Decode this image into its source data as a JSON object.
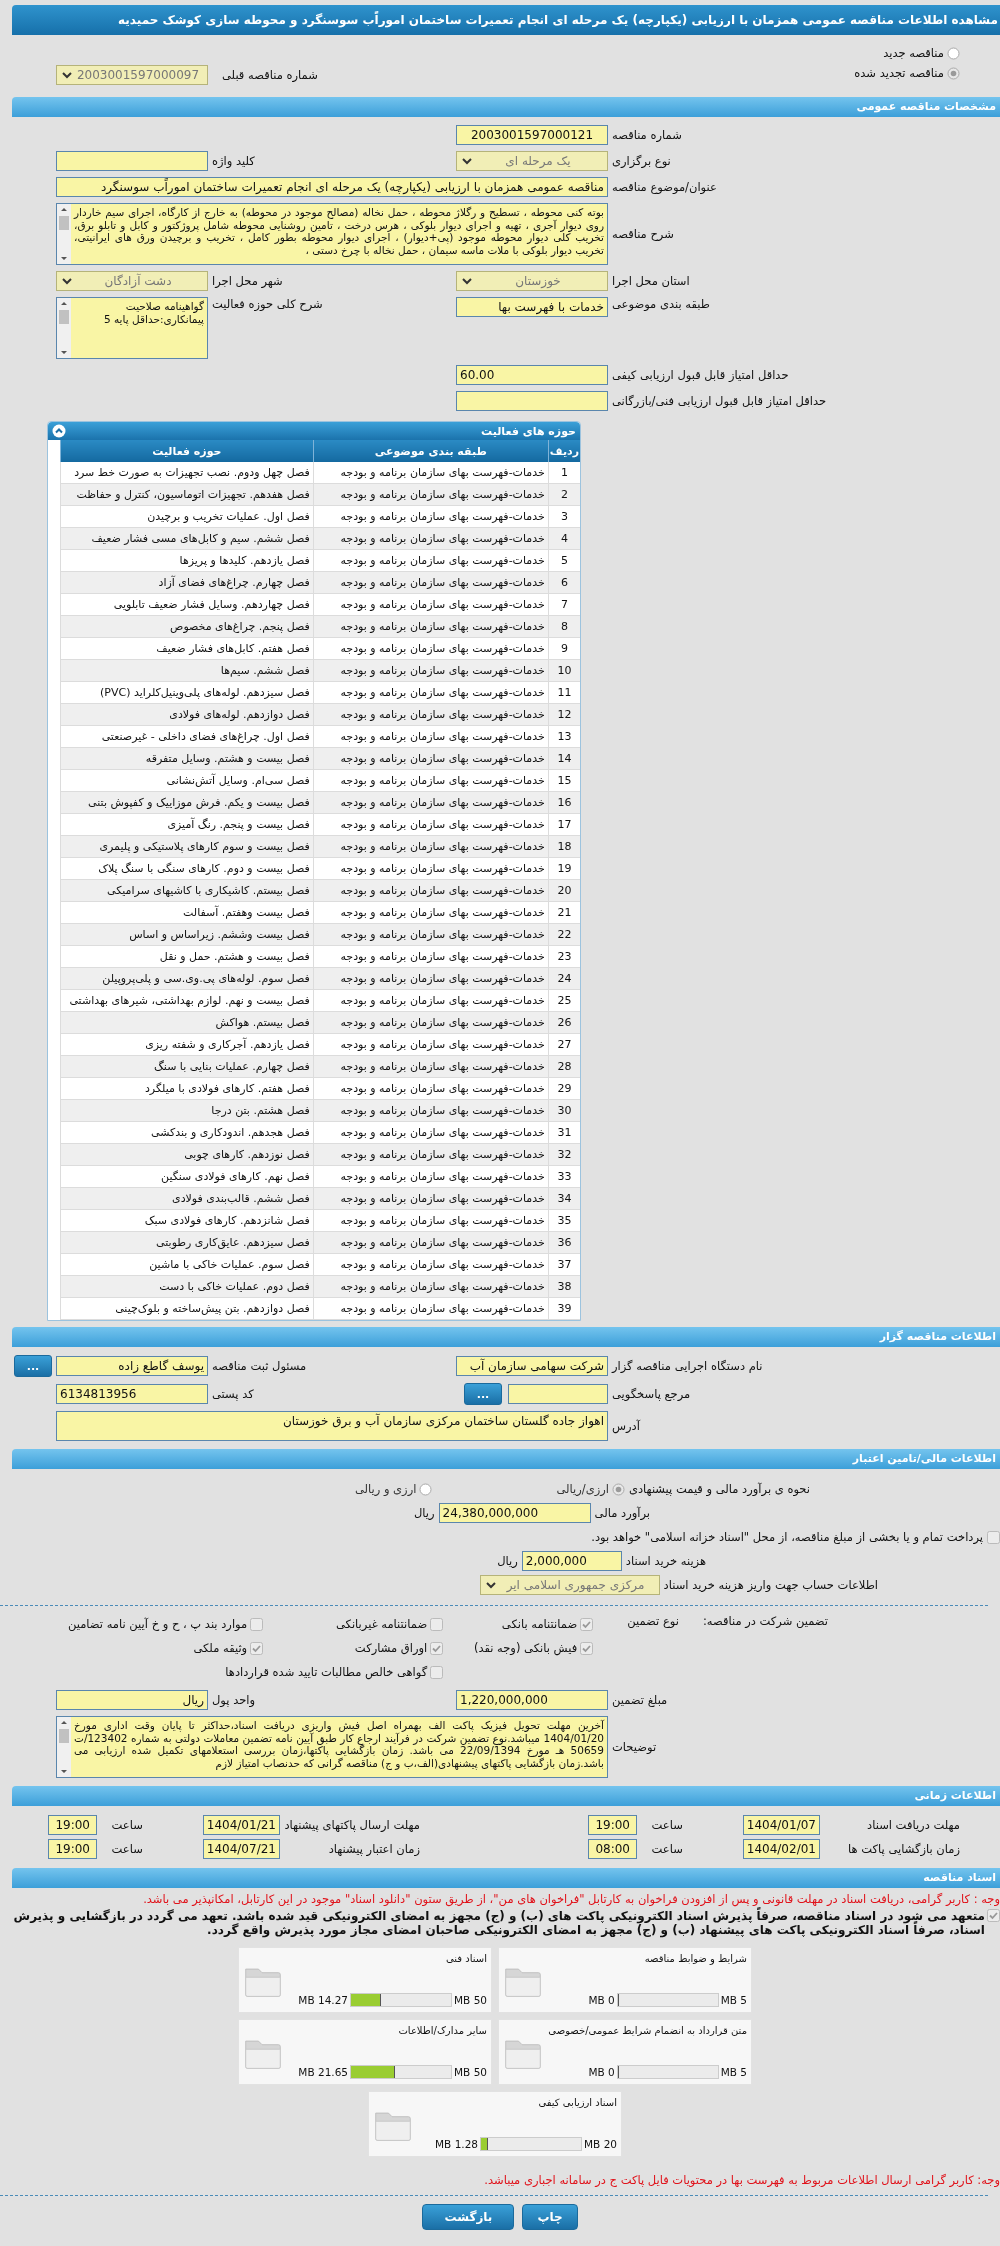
{
  "title": "مشاهده اطلاعات مناقصه عمومی همزمان با ارزیابی (یکپارچه) یک مرحله ای انجام تعمیرات ساختمان اموراًب سوسنگرد و محوطه سازی کوشک حمیدیه",
  "renewal": {
    "options": [
      {
        "label": "مناقصه جدید",
        "selected": false
      },
      {
        "label": "مناقصه تجدید شده",
        "selected": true
      }
    ],
    "previous": {
      "label": "شماره مناقصه قبلی",
      "value": "2003001597000097"
    }
  },
  "general": {
    "header": "مشخصات مناقصه عمومی",
    "tender_number": {
      "label": "شماره مناقصه",
      "value": "2003001597000121"
    },
    "holding_type": {
      "label": "نوع برگزاری",
      "value": "یک مرحله ای"
    },
    "keyword": {
      "label": "کلید واژه"
    },
    "subject": {
      "label": "عنوان/موضوع مناقصه",
      "value": "مناقصه عمومی همزمان با ارزیابی (یکپارچه) یک مرحله ای انجام تعمیرات ساختمان اموراًب سوسنگرد"
    },
    "description": {
      "label": "شرح مناقصه",
      "value": "بوته کنی محوطه ، تسطیح و رگلاژ محوطه ، حمل نخاله (مصالح موجود در محوطه) به خارج از کارگاه، اجرای سیم خاردار روی دیوار آجری ، تهیه و اجرای دیوار بلوکی ، هرس درخت ، تامین روشنایی محوطه شامل پروژکتور و کابل و تابلو برق، تخریب کلی دیوار محوطه موجود (پی+دیوار) ، اجرای دیوار محوطه بطور کامل ، تخریب و برچیدن ورق های ایرانیتی، تخریب دیوار بلوکی با ملات ماسه سیمان ، حمل نخاله با چرخ دستی ،"
    },
    "province": {
      "label": "استان محل اجرا",
      "value": "خوزستان"
    },
    "city": {
      "label": "شهر محل اجرا",
      "value": "دشت آزادگان"
    },
    "category": {
      "label": "طبقه بندی موضوعی",
      "value": "خدمات با فهرست بها"
    },
    "activity_summary": {
      "label": "شرح کلی حوزه فعالیت",
      "value": "گواهینامه صلاحیت پیمانکاری:حداقل پایه 5"
    },
    "min_quality_score": {
      "label": "حداقل امتیاز قابل قبول ارزیابی کیفی",
      "value": "60.00"
    },
    "min_technical_score": {
      "label": "حداقل امتیاز قابل قبول ارزیابی فنی/بازرگانی"
    }
  },
  "activity_table": {
    "title": "حوزه های فعالیت",
    "columns": [
      "ردیف",
      "طبقه بندی موضوعی",
      "حوزه فعالیت"
    ],
    "rows": [
      [
        "1",
        "خدمات-فهرست بهای سازمان برنامه و بودجه",
        "فصل چهل ودوم. نصب تجهیزات به صورت خط سرد"
      ],
      [
        "2",
        "خدمات-فهرست بهای سازمان برنامه و بودجه",
        "فصل هفدهم. تجهیزات اتوماسیون، کنترل و حفاظت"
      ],
      [
        "3",
        "خدمات-فهرست بهای سازمان برنامه و بودجه",
        "فصل اول. عملیات تخریب و برچیدن"
      ],
      [
        "4",
        "خدمات-فهرست بهای سازمان برنامه و بودجه",
        "فصل ششم. سیم و کابل‌های مسی فشار ضعیف"
      ],
      [
        "5",
        "خدمات-فهرست بهای سازمان برنامه و بودجه",
        "فصل یازدهم. کلیدها و پریزها"
      ],
      [
        "6",
        "خدمات-فهرست بهای سازمان برنامه و بودجه",
        "فصل چهارم. چراغ‌های فضای آزاد"
      ],
      [
        "7",
        "خدمات-فهرست بهای سازمان برنامه و بودجه",
        "فصل چهاردهم. وسایل فشار ضعیف تابلویی"
      ],
      [
        "8",
        "خدمات-فهرست بهای سازمان برنامه و بودجه",
        "فصل پنجم. چراغ‌های مخصوص"
      ],
      [
        "9",
        "خدمات-فهرست بهای سازمان برنامه و بودجه",
        "فصل هفتم. کابل‌های فشار ضعیف"
      ],
      [
        "10",
        "خدمات-فهرست بهای سازمان برنامه و بودجه",
        "فصل ششم. سیم‌ها"
      ],
      [
        "11",
        "خدمات-فهرست بهای سازمان برنامه و بودجه",
        "فصل سیزدهم. لوله‌های پلی‌وینیل‌کلراید (PVC)"
      ],
      [
        "12",
        "خدمات-فهرست بهای سازمان برنامه و بودجه",
        "فصل دوازدهم. لوله‌های فولادی"
      ],
      [
        "13",
        "خدمات-فهرست بهای سازمان برنامه و بودجه",
        "فصل اول. چراغ‌های فضای داخلی - غیرصنعتی"
      ],
      [
        "14",
        "خدمات-فهرست بهای سازمان برنامه و بودجه",
        "فصل بیست و هشتم. وسایل متفرقه"
      ],
      [
        "15",
        "خدمات-فهرست بهای سازمان برنامه و بودجه",
        "فصل سی‌ام. وسایل آتش‌نشانی"
      ],
      [
        "16",
        "خدمات-فهرست بهای سازمان برنامه و بودجه",
        "فصل بیست و یکم. فرش موزاییک و کفپوش بتنی"
      ],
      [
        "17",
        "خدمات-فهرست بهای سازمان برنامه و بودجه",
        "فصل بیست و پنجم. رنگ آمیزی"
      ],
      [
        "18",
        "خدمات-فهرست بهای سازمان برنامه و بودجه",
        "فصل بیست و سوم کارهای پلاستیکی و پلیمری"
      ],
      [
        "19",
        "خدمات-فهرست بهای سازمان برنامه و بودجه",
        "فصل بیست و دوم. کارهای سنگی با سنگ پلاک"
      ],
      [
        "20",
        "خدمات-فهرست بهای سازمان برنامه و بودجه",
        "فصل بیستم. کاشیکاری با کاشیهای سرامیکی"
      ],
      [
        "21",
        "خدمات-فهرست بهای سازمان برنامه و بودجه",
        "فصل بیست وهفتم. آسفالت"
      ],
      [
        "22",
        "خدمات-فهرست بهای سازمان برنامه و بودجه",
        "فصل بیست وششم. زیراساس و اساس"
      ],
      [
        "23",
        "خدمات-فهرست بهای سازمان برنامه و بودجه",
        "فصل بیست و هشتم. حمل و نقل"
      ],
      [
        "24",
        "خدمات-فهرست بهای سازمان برنامه و بودجه",
        "فصل سوم. لوله‌های پی.وی.سی و پلی‌پروپیلن"
      ],
      [
        "25",
        "خدمات-فهرست بهای سازمان برنامه و بودجه",
        "فصل بیست و نهم. لوازم بهداشتی، شیرهای بهداشتی"
      ],
      [
        "26",
        "خدمات-فهرست بهای سازمان برنامه و بودجه",
        "فصل بیستم. هواکش"
      ],
      [
        "27",
        "خدمات-فهرست بهای سازمان برنامه و بودجه",
        "فصل یازدهم. آجرکاری و شفته ریزی"
      ],
      [
        "28",
        "خدمات-فهرست بهای سازمان برنامه و بودجه",
        "فصل چهارم. عملیات بنایی با سنگ"
      ],
      [
        "29",
        "خدمات-فهرست بهای سازمان برنامه و بودجه",
        "فصل هفتم. کارهای فولادی با میلگرد"
      ],
      [
        "30",
        "خدمات-فهرست بهای سازمان برنامه و بودجه",
        "فصل هشتم. بتن درجا"
      ],
      [
        "31",
        "خدمات-فهرست بهای سازمان برنامه و بودجه",
        "فصل هجدهم. اندودکاری و بندکشی"
      ],
      [
        "32",
        "خدمات-فهرست بهای سازمان برنامه و بودجه",
        "فصل نوزدهم. کارهای چوبی"
      ],
      [
        "33",
        "خدمات-فهرست بهای سازمان برنامه و بودجه",
        "فصل نهم. کارهای فولادی سنگین"
      ],
      [
        "34",
        "خدمات-فهرست بهای سازمان برنامه و بودجه",
        "فصل ششم. قالب‌بندی فولادی"
      ],
      [
        "35",
        "خدمات-فهرست بهای سازمان برنامه و بودجه",
        "فصل شانزدهم. کارهای فولادی سبک"
      ],
      [
        "36",
        "خدمات-فهرست بهای سازمان برنامه و بودجه",
        "فصل سیزدهم. عایق‌کاری رطوبتی"
      ],
      [
        "37",
        "خدمات-فهرست بهای سازمان برنامه و بودجه",
        "فصل سوم. عملیات خاکی با ماشین"
      ],
      [
        "38",
        "خدمات-فهرست بهای سازمان برنامه و بودجه",
        "فصل دوم. عملیات خاکی با دست"
      ],
      [
        "39",
        "خدمات-فهرست بهای سازمان برنامه و بودجه",
        "فصل دوازدهم. بتن پیش‌ساخته و بلوک‌چینی"
      ]
    ]
  },
  "organizer": {
    "header": "اطلاعات مناقصه گزار",
    "organization": {
      "label": "نام دستگاه اجرایی مناقصه گزار",
      "value": "شرکت سهامی سازمان آب"
    },
    "registrar": {
      "label": "مسئول ثبت مناقصه",
      "value": "یوسف گاطع زاده",
      "button": "..."
    },
    "reference": {
      "label": "مرجع پاسخگویی",
      "button": "..."
    },
    "postal_code": {
      "label": "کد پستی",
      "value": "6134813956"
    },
    "address": {
      "label": "آدرس",
      "value": "اهواز جاده گلستان ساختمان مرکزی سازمان آب و برق خوزستان"
    }
  },
  "finance": {
    "header": "اطلاعات مالی/تامین اعتبار",
    "estimate_type": {
      "label": "نحوه ی برآورد مالی و قیمت پیشنهادی",
      "options": [
        {
          "label": "ارزی/ریالی",
          "selected": true
        },
        {
          "label": "ارزی و ریالی",
          "selected": false
        }
      ]
    },
    "estimate": {
      "label": "برآورد مالی",
      "value": "24,380,000,000",
      "unit": "ریال"
    },
    "treasury": {
      "label": "پرداخت تمام و یا بخشی از مبلغ مناقصه، از محل \"اسناد خزانه اسلامی\" خواهد بود.",
      "checked": false
    },
    "doc_fee": {
      "label": "هزینه خرید اسناد",
      "value": "2,000,000",
      "unit": "ریال"
    },
    "account": {
      "label": "اطلاعات حساب جهت واریز هزینه خرید اسناد",
      "value": "مرکزی جمهوری اسلامی ایر"
    },
    "guarantee": {
      "label": "تضمین شرکت در مناقصه:",
      "type_label": "نوع تضمین",
      "options": [
        {
          "label": "ضمانتنامه بانکی",
          "checked": true
        },
        {
          "label": "ضمانتنامه غیربانکی",
          "checked": false
        },
        {
          "label": "موارد بند پ ، ح و خ آیین نامه تضامین",
          "checked": false
        },
        {
          "label": "فیش بانکی (وجه نقد)",
          "checked": true
        },
        {
          "label": "اوراق مشارکت",
          "checked": true
        },
        {
          "label": "وثیقه ملکی",
          "checked": true
        },
        {
          "label": "گواهی خالص مطالبات تایید شده قراردادها",
          "checked": false
        }
      ]
    },
    "guarantee_amount": {
      "label": "مبلغ تضمین",
      "value": "1,220,000,000"
    },
    "currency": {
      "label": "واحد پول",
      "value": "ریال"
    },
    "explanation": {
      "label": "توضیحات",
      "value": "آخرین مهلت تحویل فیزیک پاکت الف بهمراه اصل فیش واریزی دریافت اسناد،حداکثر تا پایان وقت اداری مورخ 1404/01/20 میباشد.نوع تضمین شرکت در فرآیند ارجاع کار طبق آیین نامه تضمین معاملات دولتی به شماره 123402/ت 50659 هـ مورخ 22/09/1394 می باشد. زمان بازگشایی پاکتها،زمان بررسی استعلامهای تکمیل شده ارزیابی می باشد.زمان بازگشایی پاکتهای پیشنهادی(الف،ب و ج) مناقصه گرانی که حدنصاب امتیاز لازم"
    }
  },
  "timing": {
    "header": "اطلاعات زمانی",
    "items": [
      {
        "label": "مهلت دریافت اسناد",
        "value": "1404/01/07",
        "time_label": "ساعت",
        "time": "19:00"
      },
      {
        "label": "مهلت ارسال پاکتهای پیشنهاد",
        "value": "1404/01/21",
        "time_label": "ساعت",
        "time": "19:00"
      },
      {
        "label": "زمان بازگشایی پاکت ها",
        "value": "1404/02/01",
        "time_label": "ساعت",
        "time": "08:00"
      },
      {
        "label": "زمان اعتبار پیشنهاد",
        "value": "1404/07/21",
        "time_label": "ساعت",
        "time": "19:00"
      }
    ]
  },
  "documents": {
    "header": "اسناد مناقصه",
    "notice": "وجه : کاربر گرامی، دریافت اسناد در مهلت قانونی و پس از افزودن فراخوان به کارتابل \"فراخوان های من\"، از طریق ستون \"دانلود اسناد\" موجود در این کارتابل، امکانپذیر می باشد.",
    "pledge": {
      "text": "متعهد می شود در اسناد مناقصه، صرفاً پذیرش اسناد الکترونیکی پاکت های (ب) و (ج) مجهز به امضای الکترونیکی قید شده باشد. تعهد می گردد در بازگشایی و پذیرش اسناد، صرفاً اسناد الکترونیکی پاکت های پیشنهاد (ب) و (ج) مجهز به امضای الکترونیکی صاحبان امضای مجاز مورد پذیرش واقع گردد.",
      "checked": true
    },
    "files": [
      {
        "name": "شرایط و ضوابط مناقصه",
        "used": "0 MB",
        "max": "5 MB",
        "level": 0
      },
      {
        "name": "اسناد فنی",
        "used": "14.27 MB",
        "max": "50 MB",
        "level": 0.285
      },
      {
        "name": "متن قرارداد به انضمام شرایط عمومی/خصوصی",
        "used": "0 MB",
        "max": "5 MB",
        "level": 0
      },
      {
        "name": "سایر مدارک/اطلاعات",
        "used": "21.65 MB",
        "max": "50 MB",
        "level": 0.433
      },
      {
        "name": "اسناد ارزیابی کیفی",
        "used": "1.28 MB",
        "max": "20 MB",
        "level": 0.064
      }
    ],
    "footer_note": "وجه: کاربر گرامی ارسال اطلاعات مربوط به فهرست بها در محتویات فایل پاکت ج در سامانه اجباری میباشد."
  },
  "buttons": [
    "چاپ",
    "بازگشت"
  ]
}
